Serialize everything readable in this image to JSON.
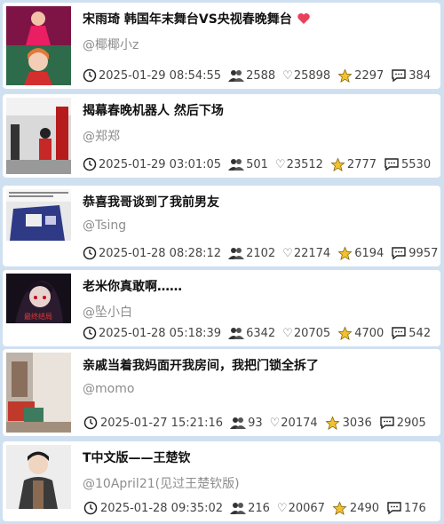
{
  "posts": [
    {
      "title": "宋雨琦 韩国年末舞台VS央视春晚舞台",
      "author": "@椰椰小z",
      "date": "2025-01-29 08:54:55",
      "views": "2588",
      "likes": "25898",
      "stars": "2297",
      "comments": "384",
      "title_badge": "heart-badge-icon"
    },
    {
      "title": "揭幕春晚机器人 然后下场",
      "author": "@郑郑",
      "date": "2025-01-29 03:01:05",
      "views": "501",
      "likes": "23512",
      "stars": "2777",
      "comments": "5530"
    },
    {
      "title": "恭喜我哥谈到了我前男友",
      "author": "@Tsing",
      "date": "2025-01-28 08:28:12",
      "views": "2102",
      "likes": "22174",
      "stars": "6194",
      "comments": "9957"
    },
    {
      "title": "老米你真敢啊……",
      "author": "@坠小白",
      "date": "2025-01-28 05:18:39",
      "views": "6342",
      "likes": "20705",
      "stars": "4700",
      "comments": "542",
      "thumb_text": "最终结局"
    },
    {
      "title": "亲戚当着我妈面开我房间，我把门锁全拆了",
      "author": "@momo",
      "date": "2025-01-27 15:21:16",
      "views": "93",
      "likes": "20174",
      "stars": "3036",
      "comments": "2905"
    },
    {
      "title": "T中文版——王楚钦",
      "author": "@10April21(见过王楚钦版)",
      "date": "2025-01-28 09:35:02",
      "views": "216",
      "likes": "20067",
      "stars": "2490",
      "comments": "176"
    }
  ],
  "colors": {
    "background": "#cfe0f1",
    "card": "#ffffff",
    "star": "#f2c12e",
    "heart_badge": "#e8425a"
  },
  "icons": {
    "clock": "clock-icon",
    "views": "people-icon",
    "likes": "heart-icon",
    "stars": "star-icon",
    "comments": "comment-icon"
  }
}
